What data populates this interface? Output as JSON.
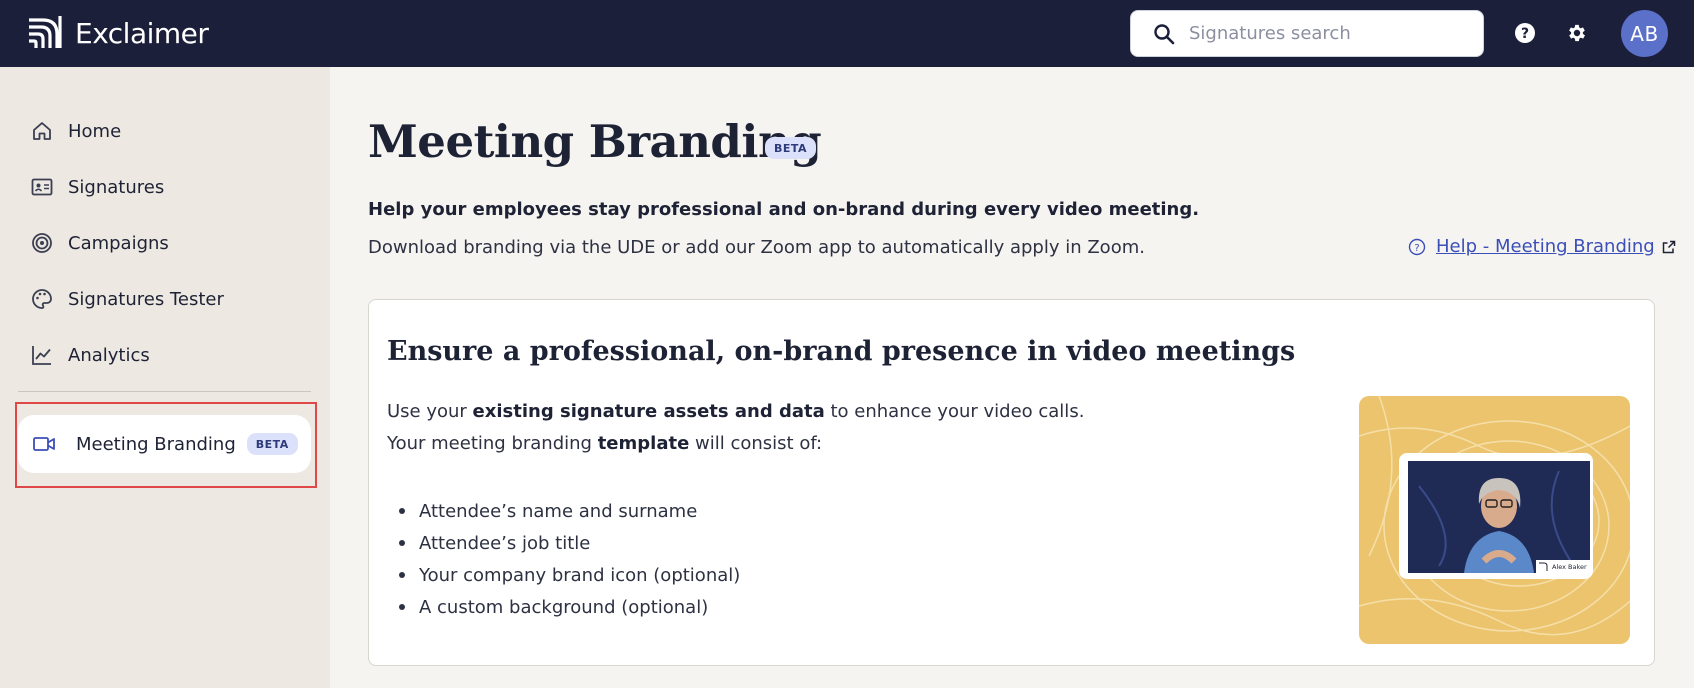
{
  "header": {
    "brand": "Exclaimer",
    "search_placeholder": "Signatures search",
    "avatar_initials": "AB",
    "icons": [
      "help-icon",
      "settings-icon",
      "search-icon"
    ]
  },
  "sidebar": {
    "items": [
      {
        "label": "Home",
        "icon": "home-icon"
      },
      {
        "label": "Signatures",
        "icon": "id-card-icon"
      },
      {
        "label": "Campaigns",
        "icon": "target-icon"
      },
      {
        "label": "Signatures Tester",
        "icon": "palette-icon"
      },
      {
        "label": "Analytics",
        "icon": "line-chart-icon"
      }
    ],
    "active_item": {
      "label": "Meeting Branding",
      "badge": "BETA",
      "icon": "video-camera-icon"
    }
  },
  "main": {
    "title": "Meeting Branding",
    "title_badge": "BETA",
    "subtitle": "Help your employees stay professional and on-brand during every video meeting.",
    "description": "Download branding via the UDE or add our Zoom app to automatically apply in Zoom.",
    "help_link": "Help -  Meeting Branding",
    "card": {
      "title": "Ensure a professional, on-brand presence in video meetings",
      "line1_pre": "Use your ",
      "line1_bold": "existing signature assets and data",
      "line1_post": " to enhance your video calls.",
      "line2_pre": "Your meeting branding ",
      "line2_bold": "template",
      "line2_post": " will consist of:",
      "bullets": [
        "Attendee’s name and surname",
        "Attendee’s job title",
        "Your company brand icon (optional)",
        "A custom background (optional)"
      ],
      "preview_name_tag": "Alex Baker"
    }
  },
  "colors": {
    "topbar": "#1c1f3a",
    "sidebar": "#ede8e1",
    "page": "#f6f4f1",
    "accent": "#3a4fb8",
    "beta_bg": "#dbe1fb",
    "highlight": "#e04848",
    "preview_bg": "#ecc46e"
  }
}
